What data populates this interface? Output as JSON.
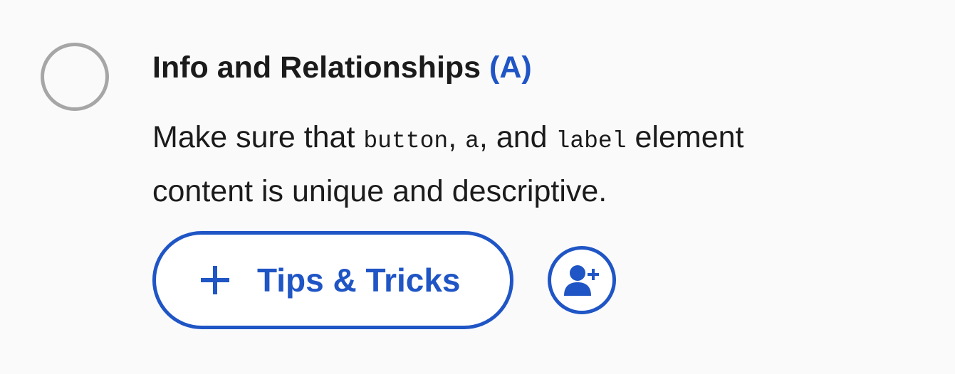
{
  "checklist_item": {
    "title": "Info and Relationships",
    "level": "(A)",
    "description": {
      "line1": {
        "t1": "Make sure that ",
        "code1": "button",
        "t2": ", ",
        "code2": "a",
        "t3": ", and ",
        "code3": "label",
        "t4": " element"
      },
      "line2": "content is unique and descriptive."
    },
    "tips_button_label": "Tips & Tricks",
    "icons": {
      "status": "empty-circle-icon",
      "add": "plus-icon",
      "assign": "user-plus-icon"
    }
  },
  "colors": {
    "accent": "#1f55c5",
    "text": "#1b1b1b",
    "circle": "#a6a6a6",
    "background": "#fafafb"
  }
}
